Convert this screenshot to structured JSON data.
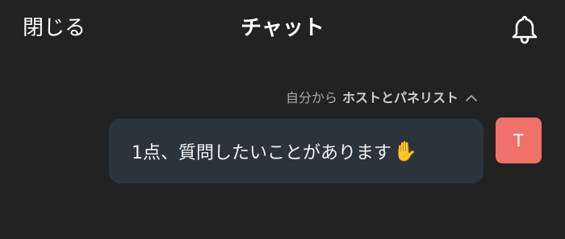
{
  "header": {
    "close_label": "閉じる",
    "title": "チャット"
  },
  "icons": {
    "notifications": "bell-icon",
    "recipient_toggle": "chevron-up-icon"
  },
  "message": {
    "from_label": "自分から",
    "to_label": "ホストとパネリスト",
    "text": "1点、質問したいことがあります",
    "emoji": "✋",
    "avatar_initial": "T"
  },
  "colors": {
    "background": "#222222",
    "bubble": "#2b333d",
    "avatar": "#f0706a",
    "meta_text": "#a9a9a9"
  }
}
